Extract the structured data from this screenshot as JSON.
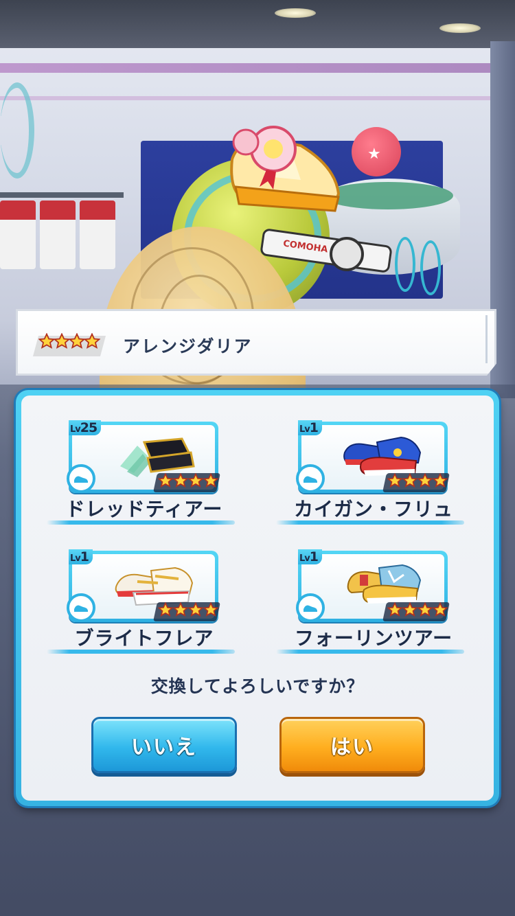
{
  "title_bar": {
    "rarity": 4,
    "name": "アレンジダリア"
  },
  "items": [
    {
      "level_prefix": "Lv",
      "level": "25",
      "name": "ドレッドティアー",
      "rarity": 4,
      "icon": "shoe-black-icon"
    },
    {
      "level_prefix": "Lv",
      "level": "1",
      "name": "カイガン・フリュ",
      "rarity": 4,
      "icon": "shoe-blue-red-icon"
    },
    {
      "level_prefix": "Lv",
      "level": "1",
      "name": "ブライトフレア",
      "rarity": 4,
      "icon": "shoe-white-gold-icon"
    },
    {
      "level_prefix": "Lv",
      "level": "1",
      "name": "フォーリンツアー",
      "rarity": 4,
      "icon": "shoe-gold-blue-icon"
    }
  ],
  "dialog": {
    "question": "交換してよろしいですか？",
    "no_label": "いいえ",
    "yes_label": "はい"
  },
  "background": {
    "robot_logo": "COMOHA"
  },
  "colors": {
    "accent_blue": "#36b3e2",
    "button_orange": "#ffae1f",
    "star_gold": "#ffcf3a",
    "text_navy": "#243453"
  }
}
